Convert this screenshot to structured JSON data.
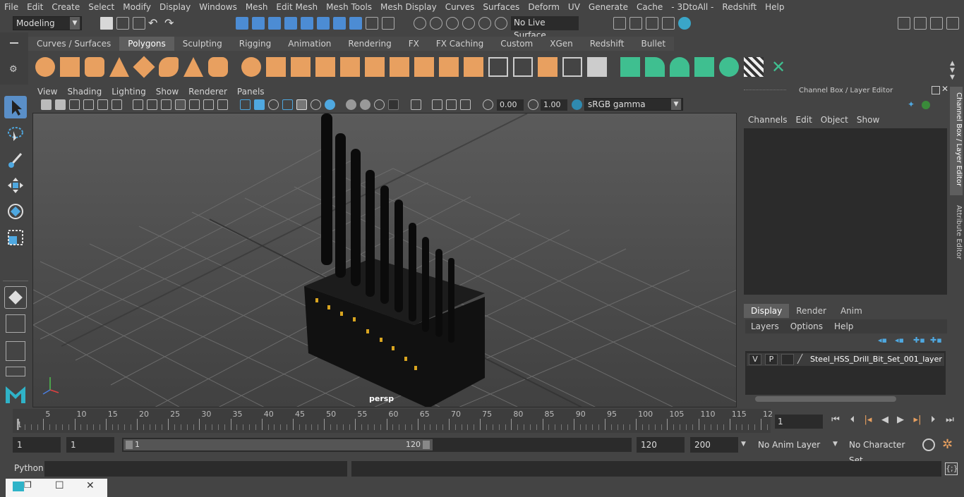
{
  "menubar": {
    "items": [
      "File",
      "Edit",
      "Create",
      "Select",
      "Modify",
      "Display",
      "Windows",
      "Mesh",
      "Edit Mesh",
      "Mesh Tools",
      "Mesh Display",
      "Curves",
      "Surfaces",
      "Deform",
      "UV",
      "Generate",
      "Cache",
      "- 3DtoAll -",
      "Redshift",
      "Help"
    ]
  },
  "statusline": {
    "mode": "Modeling",
    "live_surface": "No Live Surface"
  },
  "shelf": {
    "tabs": [
      "Curves / Surfaces",
      "Polygons",
      "Sculpting",
      "Rigging",
      "Animation",
      "Rendering",
      "FX",
      "FX Caching",
      "Custom",
      "XGen",
      "Redshift",
      "Bullet"
    ],
    "active_tab": "Polygons"
  },
  "viewport": {
    "menus": [
      "View",
      "Shading",
      "Lighting",
      "Show",
      "Renderer",
      "Panels"
    ],
    "exposure": "0.00",
    "gamma": "1.00",
    "colorspace": "sRGB gamma",
    "camera_label": "persp"
  },
  "channel_box": {
    "title": "Channel Box / Layer Editor",
    "menus": [
      "Channels",
      "Edit",
      "Object",
      "Show"
    ],
    "layer_tabs": [
      "Display",
      "Render",
      "Anim"
    ],
    "active_layer_tab": "Display",
    "layer_menus": [
      "Layers",
      "Options",
      "Help"
    ],
    "layer": {
      "visible": "V",
      "playback": "P",
      "name": "Steel_HSS_Drill_Bit_Set_001_layer"
    }
  },
  "side_tabs": [
    "Channel Box / Layer Editor",
    "Attribute Editor"
  ],
  "timeline": {
    "ticks": [
      "5",
      "10",
      "15",
      "20",
      "25",
      "30",
      "35",
      "40",
      "45",
      "50",
      "55",
      "60",
      "65",
      "70",
      "75",
      "80",
      "85",
      "90",
      "95",
      "100",
      "105",
      "110",
      "115",
      "12"
    ],
    "current_frame_marker": "1",
    "current_frame": "1"
  },
  "range": {
    "start": "1",
    "playback_start": "1",
    "handle_start": "1",
    "handle_end": "120",
    "playback_end": "120",
    "end": "200",
    "anim_layer": "No Anim Layer",
    "character_set": "No Character Set"
  },
  "command_line": {
    "language": "Python"
  },
  "colors": {
    "accent": "#5a8fc8",
    "shelf_icon": "#e8a060",
    "shelf_icon_green": "#3fbf90"
  }
}
